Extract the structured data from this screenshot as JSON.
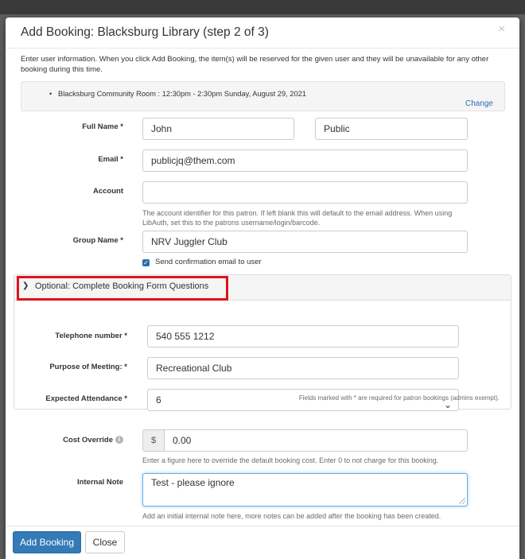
{
  "modal": {
    "title": "Add Booking: Blacksburg Library (step 2 of 3)",
    "close_icon": "×",
    "intro": "Enter user information. When you click Add Booking, the item(s) will be reserved for the given user and they will be unavailable for any other booking during this time.",
    "summary_item": "Blacksburg Community Room : 12:30pm - 2:30pm Sunday, August 29, 2021",
    "change_link": "Change"
  },
  "form": {
    "full_name_label": "Full Name *",
    "first_name": "John",
    "last_name": "Public",
    "email_label": "Email *",
    "email": "publicjq@them.com",
    "account_label": "Account",
    "account": "",
    "account_help": "The account identifier for this patron. If left blank this will default to the email address. When using LibAuth, set this to the patrons username/login/barcode.",
    "group_label": "Group Name *",
    "group": "NRV Juggler Club",
    "confirm_label": "Send confirmation email to user",
    "confirm_checked": true
  },
  "optional": {
    "heading": "Optional: Complete Booking Form Questions",
    "telephone_label": "Telephone number *",
    "telephone": "540 555 1212",
    "purpose_label": "Purpose of Meeting: *",
    "purpose": "Recreational Club",
    "attendance_label": "Expected Attendance *",
    "attendance": "6",
    "fields_note": "Fields marked with * are required for patron bookings (admins exempt).",
    "highlight_color": "#e0121b"
  },
  "cost": {
    "label": "Cost Override",
    "currency": "$",
    "value": "0.00",
    "help": "Enter a figure here to override the default booking cost. Enter 0 to not charge for this booking."
  },
  "note": {
    "label": "Internal Note",
    "value": "Test - please ignore",
    "help": "Add an initial internal note here, more notes can be added after the booking has been created."
  },
  "buttons": {
    "add_booking": "Add Booking",
    "close": "Close"
  },
  "colors": {
    "primary": "#337ab7",
    "link": "#2a6fb0"
  }
}
